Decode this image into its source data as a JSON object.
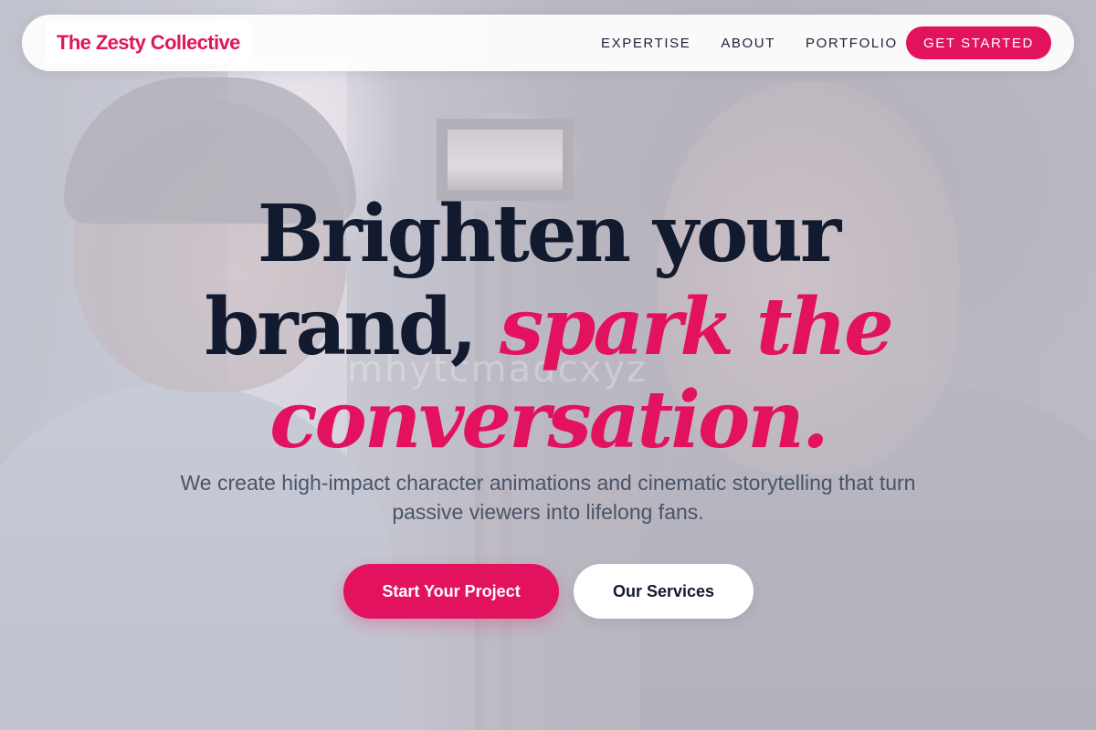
{
  "brand": {
    "name": "The Zesty Collective",
    "accent_color": "#e3125f",
    "dark_color": "#111a2e"
  },
  "nav": {
    "links": [
      "EXPERTISE",
      "ABOUT",
      "PORTFOLIO"
    ],
    "cta_label": "GET STARTED"
  },
  "hero": {
    "headline_line1": "Brighten your",
    "headline_line2_plain": "brand, ",
    "headline_line2_accent": "spark the",
    "headline_line3_accent": "conversation.",
    "subtitle": "We create high-impact character animations and cinematic storytelling that turn passive viewers into lifelong fans.",
    "primary_button": "Start Your Project",
    "secondary_button": "Our Services",
    "watermark": "mhytcmadcxyz"
  }
}
